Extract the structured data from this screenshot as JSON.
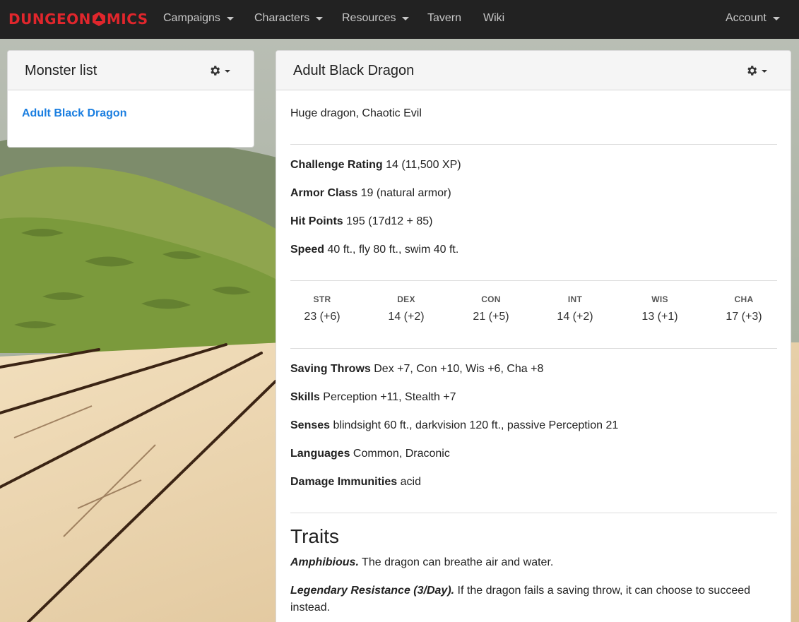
{
  "brand": {
    "name_prefix": "DUNGEON",
    "name_suffix": "MICS",
    "color": "#e0262c"
  },
  "nav": {
    "items": [
      {
        "label": "Campaigns",
        "dropdown": true
      },
      {
        "label": "Characters",
        "dropdown": true
      },
      {
        "label": "Resources",
        "dropdown": true
      },
      {
        "label": "Tavern",
        "dropdown": false
      },
      {
        "label": "Wiki",
        "dropdown": false
      }
    ],
    "account": {
      "label": "Account",
      "dropdown": true
    }
  },
  "monster_list": {
    "title": "Monster list",
    "items": [
      {
        "label": "Adult Black Dragon"
      }
    ]
  },
  "monster": {
    "name": "Adult Black Dragon",
    "type_line": "Huge dragon, Chaotic Evil",
    "core": [
      {
        "label": "Challenge Rating",
        "value": "14 (11,500 XP)"
      },
      {
        "label": "Armor Class",
        "value": "19 (natural armor)"
      },
      {
        "label": "Hit Points",
        "value": "195 (17d12 + 85)"
      },
      {
        "label": "Speed",
        "value": "40 ft., fly 80 ft., swim 40 ft."
      }
    ],
    "abilities": [
      {
        "label": "STR",
        "value": "23 (+6)"
      },
      {
        "label": "DEX",
        "value": "14 (+2)"
      },
      {
        "label": "CON",
        "value": "21 (+5)"
      },
      {
        "label": "INT",
        "value": "14 (+2)"
      },
      {
        "label": "WIS",
        "value": "13 (+1)"
      },
      {
        "label": "CHA",
        "value": "17 (+3)"
      }
    ],
    "details": [
      {
        "label": "Saving Throws",
        "value": "Dex +7, Con +10, Wis +6, Cha +8"
      },
      {
        "label": "Skills",
        "value": "Perception +11, Stealth +7"
      },
      {
        "label": "Senses",
        "value": "blindsight 60 ft., darkvision 120 ft., passive Perception 21"
      },
      {
        "label": "Languages",
        "value": "Common, Draconic"
      },
      {
        "label": "Damage Immunities",
        "value": "acid"
      }
    ],
    "traits_heading": "Traits",
    "traits": [
      {
        "name": "Amphibious.",
        "text": "The dragon can breathe air and water."
      },
      {
        "name": "Legendary Resistance (3/Day).",
        "text": "If the dragon fails a saving throw, it can choose to succeed instead."
      }
    ]
  },
  "colors": {
    "navbar": "#222222",
    "link": "#1a7ee0",
    "card_header": "#f5f5f5"
  }
}
